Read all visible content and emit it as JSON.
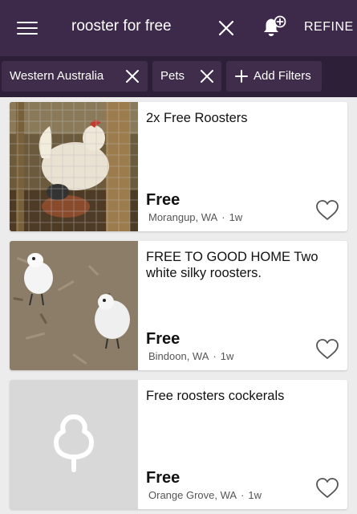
{
  "header": {
    "menu_icon": "hamburger-menu-icon",
    "search_query": "rooster for free",
    "clear_icon": "close-icon",
    "alert_icon": "bell-add-icon",
    "refine_label": "REFINE",
    "background_color": "#3d2a4a"
  },
  "filters": {
    "chips": [
      {
        "label": "Western Australia",
        "icon": "close-icon"
      },
      {
        "label": "Pets",
        "icon": "close-icon"
      }
    ],
    "add_filters_label": "Add Filters",
    "add_icon": "plus-icon",
    "background_color": "#2e1f38"
  },
  "listings": [
    {
      "title": "2x Free Roosters",
      "price": "Free",
      "location": "Morangup, WA",
      "age": "1w",
      "image": "photo of white rooster in wire cage",
      "favorite_icon": "heart-outline-icon"
    },
    {
      "title": "FREE TO GOOD HOME Two white silky roosters.",
      "price": "Free",
      "location": "Bindoon, WA",
      "age": "1w",
      "image": "photo of two white silkie roosters on wood chips",
      "favorite_icon": "heart-outline-icon"
    },
    {
      "title": "Free roosters cockerals",
      "price": "Free",
      "location": "Orange Grove, WA",
      "age": "1w",
      "image": "placeholder-tree-logo",
      "favorite_icon": "heart-outline-icon"
    }
  ]
}
